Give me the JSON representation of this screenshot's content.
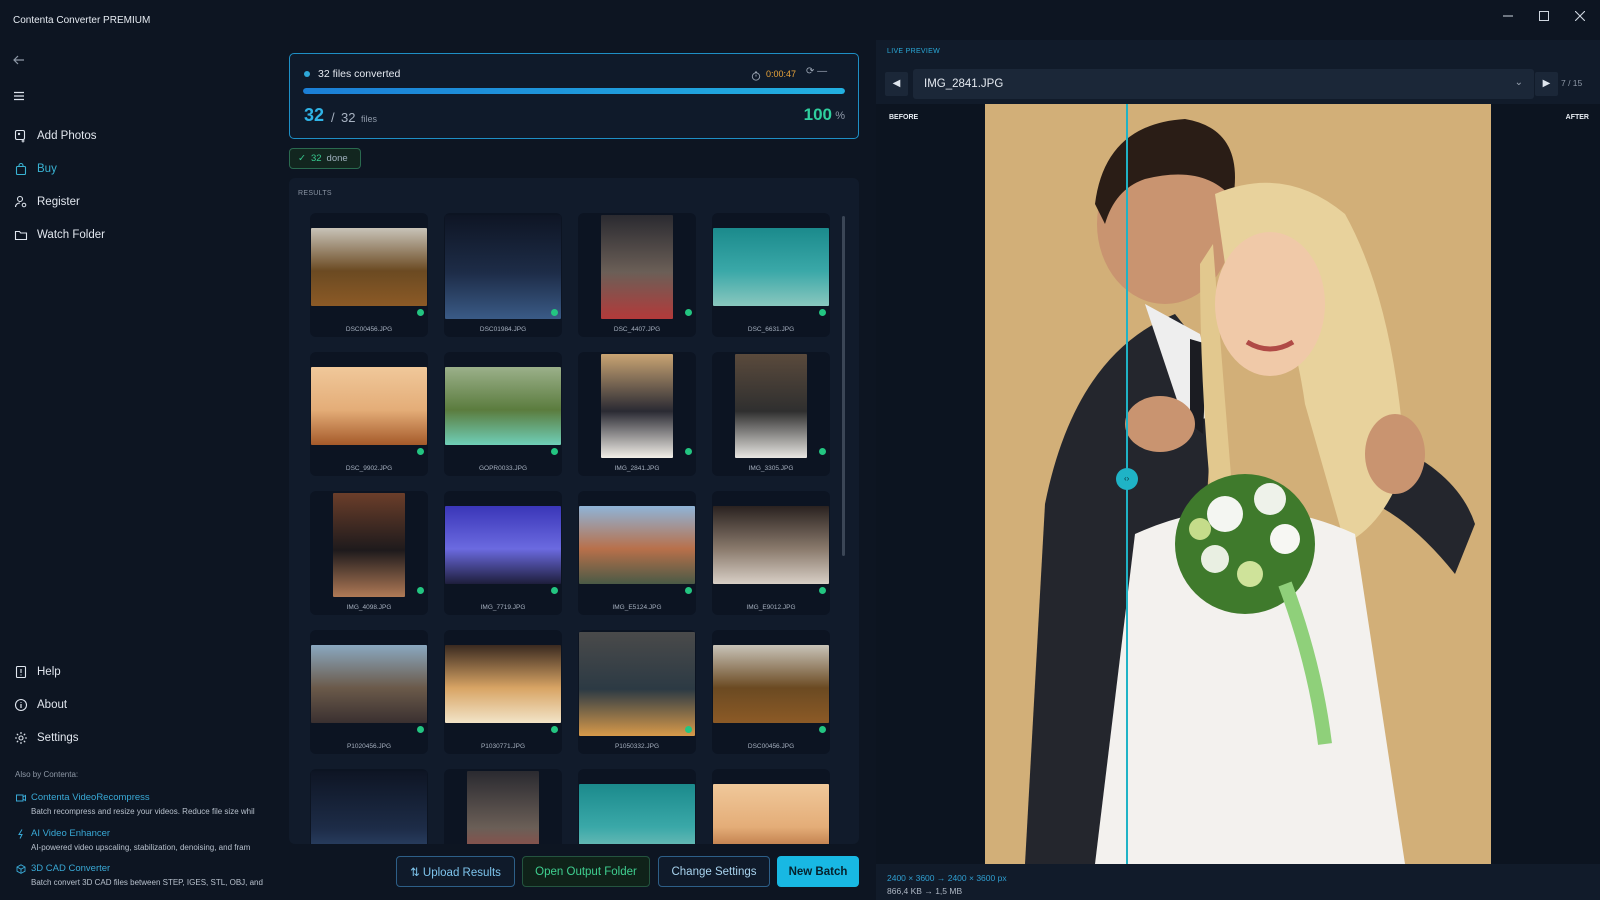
{
  "window": {
    "title": "Contenta Converter PREMIUM",
    "controls": [
      "minimize-icon",
      "maximize-icon",
      "close-icon"
    ]
  },
  "sidebar": {
    "back_icon": "arrow-left-icon",
    "menu_icon": "hamburger-icon",
    "items": [
      {
        "label": "Add Photos",
        "icon": "add-photos-icon"
      },
      {
        "label": "Buy",
        "icon": "shopping-bag-icon"
      },
      {
        "label": "Register",
        "icon": "user-key-icon"
      },
      {
        "label": "Watch Folder",
        "icon": "folder-icon"
      }
    ],
    "bottom_items": [
      {
        "label": "Help",
        "icon": "help-book-icon"
      },
      {
        "label": "About",
        "icon": "info-icon"
      },
      {
        "label": "Settings",
        "icon": "gear-icon"
      }
    ],
    "also_by": "Also by Contenta:",
    "promos": [
      {
        "title": "Contenta VideoRecompress",
        "desc": "Batch recompress and resize your videos. Reduce file size whil",
        "icon": "video-icon"
      },
      {
        "title": "AI Video Enhancer",
        "desc": "AI-powered video upscaling, stabilization, denoising, and fram",
        "icon": "sparkle-icon"
      },
      {
        "title": "3D CAD Converter",
        "desc": "Batch convert 3D CAD files between STEP, IGES, STL, OBJ, and",
        "icon": "cube-icon"
      }
    ]
  },
  "progress": {
    "title": "32 files converted",
    "elapsed": "0:00:47",
    "extra": "⟳ —",
    "done": "32",
    "separator": "/",
    "total": "32",
    "unit": "files",
    "percent": "100",
    "percent_sign": "%",
    "fraction": 1.0
  },
  "done_badge": {
    "check": "✓",
    "count": "32",
    "label": "done"
  },
  "results": {
    "label": "RESULTS",
    "files": [
      {
        "name": "DSC00456.JPG",
        "colors": [
          "#c8c3b8",
          "#6b4a22",
          "#8c5a26"
        ],
        "orient": "land"
      },
      {
        "name": "DSC01984.JPG",
        "colors": [
          "#0e1524",
          "#1d2c47",
          "#3a5a86"
        ],
        "orient": "square"
      },
      {
        "name": "DSC_4407.JPG",
        "colors": [
          "#2a2a30",
          "#6b5f57",
          "#b33a3a"
        ],
        "orient": "portrait"
      },
      {
        "name": "DSC_6631.JPG",
        "colors": [
          "#1b8a8c",
          "#3aa8a8",
          "#8ac7be"
        ],
        "orient": "land"
      },
      {
        "name": "DSC_9902.JPG",
        "colors": [
          "#f0c89a",
          "#e4ad78",
          "#a55a2a"
        ],
        "orient": "land"
      },
      {
        "name": "GOPR0033.JPG",
        "colors": [
          "#9bb08a",
          "#5b7c3e",
          "#6fcfb8"
        ],
        "orient": "land"
      },
      {
        "name": "IMG_2841.JPG",
        "colors": [
          "#c9a473",
          "#2a2a33",
          "#f2efe8"
        ],
        "orient": "portrait"
      },
      {
        "name": "IMG_3305.JPG",
        "colors": [
          "#5a4a3c",
          "#2f2f2f",
          "#e8e6e2"
        ],
        "orient": "portrait"
      },
      {
        "name": "IMG_4098.JPG",
        "colors": [
          "#6b3e2a",
          "#1e1a1c",
          "#b07a56"
        ],
        "orient": "portrait"
      },
      {
        "name": "IMG_7719.JPG",
        "colors": [
          "#3a36b8",
          "#6b6ae0",
          "#1e1e3c"
        ],
        "orient": "land"
      },
      {
        "name": "IMG_E5124.JPG",
        "colors": [
          "#8fb4d8",
          "#b8704a",
          "#4a5a46"
        ],
        "orient": "land"
      },
      {
        "name": "IMG_E9012.JPG",
        "colors": [
          "#2a2220",
          "#8a7a6c",
          "#d8cfc6"
        ],
        "orient": "land"
      },
      {
        "name": "P1020456.JPG",
        "colors": [
          "#8aa8c0",
          "#6b5a4a",
          "#3a3030"
        ],
        "orient": "land"
      },
      {
        "name": "P1030771.JPG",
        "colors": [
          "#3a2a20",
          "#d8a464",
          "#f2e4c8"
        ],
        "orient": "land"
      },
      {
        "name": "P1050332.JPG",
        "colors": [
          "#4a4a4a",
          "#2c3a44",
          "#d89a4a"
        ],
        "orient": "square"
      },
      {
        "name": "DSC00456.JPG",
        "colors": [
          "#c8c3b8",
          "#6b4a22",
          "#8c5a26"
        ],
        "orient": "land"
      },
      {
        "name": "",
        "colors": [
          "#0e1524",
          "#1d2c47",
          "#3a5a86"
        ],
        "orient": "square"
      },
      {
        "name": "",
        "colors": [
          "#2a2a30",
          "#6b5f57",
          "#b33a3a"
        ],
        "orient": "portrait"
      },
      {
        "name": "",
        "colors": [
          "#1b8a8c",
          "#3aa8a8",
          "#8ac7be"
        ],
        "orient": "land"
      },
      {
        "name": "",
        "colors": [
          "#f0c89a",
          "#e4ad78",
          "#a55a2a"
        ],
        "orient": "land"
      }
    ]
  },
  "actions": {
    "upload": "⇅  Upload Results",
    "open_folder": "Open Output Folder",
    "change_settings": "Change Settings",
    "new_batch": "New Batch"
  },
  "preview": {
    "label": "LIVE PREVIEW",
    "prev": "◀",
    "next": "▶",
    "file": "IMG_2841.JPG",
    "chevron": "⌄",
    "counter": "7  /  15",
    "before": "BEFORE",
    "after": "AFTER",
    "handle": "‹›",
    "split": 0.28,
    "dims": "2400 × 3600  →  2400 × 3600 px",
    "sizes": "866,4 KB  →  1,5 MB"
  },
  "colors": {
    "accent": "#18b8e3",
    "success": "#23c581",
    "timer": "#e9a43a",
    "background": "#0d1522"
  }
}
